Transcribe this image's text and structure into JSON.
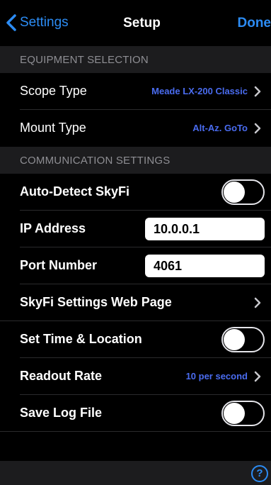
{
  "nav": {
    "back_label": "Settings",
    "title": "Setup",
    "done_label": "Done"
  },
  "sections": {
    "equipment": "EQUIPMENT SELECTION",
    "communication": "COMMUNICATION SETTINGS"
  },
  "equipment": {
    "scope_type": {
      "label": "Scope Type",
      "value": "Meade LX-200 Classic"
    },
    "mount_type": {
      "label": "Mount Type",
      "value": "Alt-Az. GoTo"
    }
  },
  "communication": {
    "auto_detect": {
      "label": "Auto-Detect SkyFi",
      "on": false
    },
    "ip_address": {
      "label": "IP Address",
      "value": "10.0.0.1"
    },
    "port_number": {
      "label": "Port Number",
      "value": "4061"
    },
    "web_page": {
      "label": "SkyFi Settings Web Page"
    },
    "set_time": {
      "label": "Set Time & Location",
      "on": false
    },
    "readout_rate": {
      "label": "Readout Rate",
      "value": "10 per second"
    },
    "save_log": {
      "label": "Save Log File",
      "on": false
    }
  },
  "toolbar": {
    "help_label": "?"
  },
  "colors": {
    "accent": "#2c8cf4",
    "value_text": "#4a6cf0",
    "section_bg": "#1c1c1e",
    "background": "#000000"
  },
  "icons": {
    "back": "chevron-left-icon",
    "disclosure": "chevron-right-icon",
    "help": "help-circle-icon"
  }
}
